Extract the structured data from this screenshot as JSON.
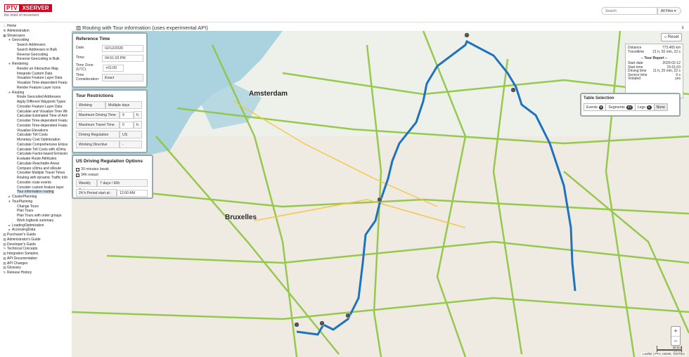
{
  "header": {
    "logo_left": "PTV",
    "logo_right": "XSERVER",
    "tagline": "the mind of movement",
    "search_placeholder": "Search",
    "filter": "All Files ▾"
  },
  "sidebar": [
    {
      "i": "⌂",
      "t": "Home",
      "l": 0
    },
    {
      "i": "⚙",
      "t": "Administration",
      "l": 0
    },
    {
      "i": "▦",
      "t": "Showcases",
      "l": 0
    },
    {
      "i": "▾",
      "t": "Geocoding",
      "l": 1
    },
    {
      "i": "",
      "t": "Search Addresses",
      "l": 2
    },
    {
      "i": "",
      "t": "Search Addresses in Bulk",
      "l": 2
    },
    {
      "i": "",
      "t": "Reverse Geocoding",
      "l": 2
    },
    {
      "i": "",
      "t": "Reverse Geocoding in Bulk",
      "l": 2
    },
    {
      "i": "▾",
      "t": "Rendering",
      "l": 1
    },
    {
      "i": "",
      "t": "Render an Interactive Map",
      "l": 2
    },
    {
      "i": "",
      "t": "Integrate Custom Data",
      "l": 2
    },
    {
      "i": "",
      "t": "Visualize Feature Layer Data",
      "l": 2
    },
    {
      "i": "",
      "t": "Visualize Time-dependent Features",
      "l": 2
    },
    {
      "i": "",
      "t": "Render Feature Layer Icons",
      "l": 2
    },
    {
      "i": "▾",
      "t": "Routing",
      "l": 1
    },
    {
      "i": "",
      "t": "Route Geocoded Addresses",
      "l": 2
    },
    {
      "i": "",
      "t": "Apply Different Waypoint Types",
      "l": 2
    },
    {
      "i": "",
      "t": "Consider Feature Layer Data",
      "l": 2
    },
    {
      "i": "",
      "t": "Calculate and Visualize Time Windows",
      "l": 2
    },
    {
      "i": "",
      "t": "Calculate Estimated Time of Arrival",
      "l": 2
    },
    {
      "i": "",
      "t": "Consider Time-dependent Features",
      "l": 2
    },
    {
      "i": "",
      "t": "Consider Time-dependent Features",
      "l": 2
    },
    {
      "i": "",
      "t": "Visualize Elevations",
      "l": 2
    },
    {
      "i": "",
      "t": "Calculate Toll Costs",
      "l": 2
    },
    {
      "i": "",
      "t": "Monetary Cost Optimization",
      "l": 2
    },
    {
      "i": "",
      "t": "Calculate Comprehensive Emissions",
      "l": 2
    },
    {
      "i": "",
      "t": "Calculate Toll Costs with xDima",
      "l": 2
    },
    {
      "i": "",
      "t": "Calculate Factor-based Emissions",
      "l": 2
    },
    {
      "i": "",
      "t": "Evaluate Route Attributes",
      "l": 2
    },
    {
      "i": "",
      "t": "Calculate Reachable Areas",
      "l": 2
    },
    {
      "i": "",
      "t": "Compare xDima and xRoute",
      "l": 2
    },
    {
      "i": "",
      "t": "Consider Multiple Travel Times",
      "l": 2
    },
    {
      "i": "",
      "t": "Routing with dynamic Traffic Info",
      "l": 2
    },
    {
      "i": "",
      "t": "Consider route events",
      "l": 2
    },
    {
      "i": "",
      "t": "Consider custom feature layer",
      "l": 2
    },
    {
      "i": "",
      "t": "Tour information routing",
      "l": 2,
      "sel": true
    },
    {
      "i": "▸",
      "t": "ClusterPlanning",
      "l": 1
    },
    {
      "i": "▾",
      "t": "TourPlanning",
      "l": 1
    },
    {
      "i": "",
      "t": "Change Tours",
      "l": 2
    },
    {
      "i": "",
      "t": "Plan Tours",
      "l": 2
    },
    {
      "i": "",
      "t": "Plan Tours with order groups",
      "l": 2
    },
    {
      "i": "",
      "t": "Work logbook summary",
      "l": 2
    },
    {
      "i": "▸",
      "t": "LoadingOptimization",
      "l": 1
    },
    {
      "i": "▸",
      "t": "AccessingData",
      "l": 1
    },
    {
      "i": "▤",
      "t": "Purchaser's Guide",
      "l": 0
    },
    {
      "i": "▤",
      "t": "Administrator's Guide",
      "l": 0
    },
    {
      "i": "▤",
      "t": "Developer's Guide",
      "l": 0
    },
    {
      "i": "✎",
      "t": "Technical Concepts",
      "l": 0
    },
    {
      "i": "▤",
      "t": "Integration Samples",
      "l": 0
    },
    {
      "i": "▤",
      "t": "API Documentation",
      "l": 0
    },
    {
      "i": "▤",
      "t": "API Changes",
      "l": 0
    },
    {
      "i": "▤",
      "t": "Glossary",
      "l": 0
    },
    {
      "i": "↻",
      "t": "Release History",
      "l": 0
    }
  ],
  "page": {
    "title": "Routing with Tour information (uses experimental API)",
    "toolbar_icons": "ℹ ⇗ ✎ ✉ ⚙"
  },
  "reference_time": {
    "title": "Reference Time",
    "date_label": "Date:",
    "date": "02/12/2020",
    "time_label": "Time:",
    "time": "04:51:03 PM",
    "tz_label": "Time Zone (UTC):",
    "tz": "+01:00",
    "tc_label": "Time Consideration:",
    "tc": "Exact"
  },
  "tour_restrictions": {
    "title": "Tour Restrictions",
    "wh_label": "Working Hours",
    "wh": "Multiple days",
    "mdt_label": "Maximum Driving Time",
    "mdt": "9",
    "mdt_unit": "h",
    "mtt_label": "Maximum Travel Time",
    "mtt": "0",
    "mtt_unit": "h",
    "dr_label": "Driving Regulation",
    "dr": "US",
    "wd_label": "Working Directive",
    "wd": "-"
  },
  "us_regulation": {
    "title": "US Driving Regulation Options",
    "opt1": "30 minutes break",
    "opt2": "34h restart",
    "wd_label": "Weekly Duty",
    "wd": "7 days / 60h",
    "start_label": "24 h Period start at :",
    "start": "12:00 AM"
  },
  "summary": {
    "rows": [
      [
        "Distance",
        "773.465 km"
      ],
      [
        "Traveltime",
        "21 h, 55 min, 22 s"
      ]
    ],
    "report_title": "-- Tour Report --",
    "report": [
      [
        "Start date",
        "2020-02-12"
      ],
      [
        "Start time",
        "15:51:03"
      ],
      [
        "Driving time",
        "11 h, 25 min, 22 s"
      ],
      [
        "Service time",
        "0 s"
      ],
      [
        "Violated",
        "yes"
      ]
    ]
  },
  "table_selection": {
    "title": "Table Selection",
    "buttons": [
      {
        "label": "Events",
        "count": "8"
      },
      {
        "label": "Segments",
        "count": "23"
      },
      {
        "label": "Legs",
        "count": "5"
      },
      {
        "label": "None",
        "count": ""
      }
    ]
  },
  "map": {
    "reset": "Reset",
    "labels": [
      "Amsterdam",
      "Bruxelles"
    ],
    "scale1": "30 km",
    "scale2": "20 mi",
    "attribution": "Leaflet | PTV, HERE, TomTom",
    "zoom_in": "+",
    "zoom_out": "−"
  }
}
